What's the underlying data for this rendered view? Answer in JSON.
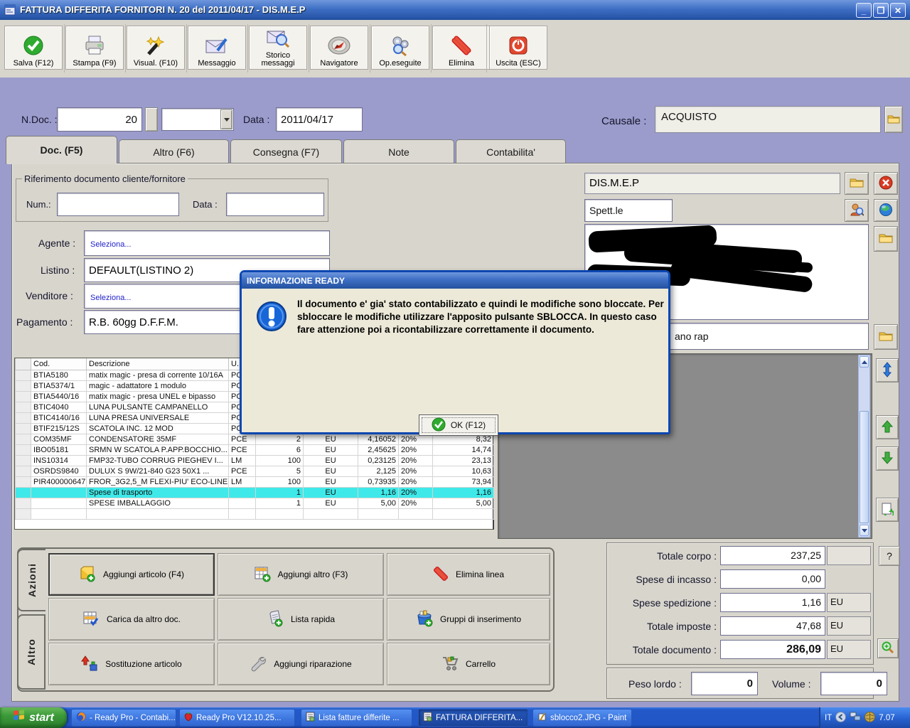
{
  "window": {
    "title": "FATTURA DIFFERITA FORNITORI N. 20  del 2011/04/17 - DIS.M.E.P"
  },
  "toolbar": {
    "buttons": [
      {
        "label": "Salva (F12)",
        "icon": "save-check-icon"
      },
      {
        "label": "Stampa (F9)",
        "icon": "printer-icon"
      },
      {
        "label": "Visual. (F10)",
        "icon": "magic-wand-icon"
      },
      {
        "label": "Messaggio",
        "icon": "envelope-pen-icon"
      },
      {
        "label": "Storico messaggi",
        "icon": "envelope-search-icon"
      },
      {
        "label": "Navigatore",
        "icon": "compass-icon"
      },
      {
        "label": "Op.eseguite",
        "icon": "gears-search-icon"
      },
      {
        "label": "Elimina",
        "icon": "red-x-icon"
      },
      {
        "label": "Uscita (ESC)",
        "icon": "power-icon"
      }
    ]
  },
  "header": {
    "ndoc_label": "N.Doc. :",
    "ndoc_value": "20",
    "data_label": "Data :",
    "data_value": "2011/04/17",
    "causale_label": "Causale :",
    "causale_value": "ACQUISTO"
  },
  "tabs": {
    "items": [
      "Doc. (F5)",
      "Altro (F6)",
      "Consegna (F7)",
      "Note",
      "Contabilita'"
    ]
  },
  "doc_tab": {
    "ref_title": "Riferimento documento cliente/fornitore",
    "num_label": "Num.:",
    "num_value": "",
    "data_label": "Data :",
    "data_value": "",
    "agente_label": "Agente :",
    "agente_value": "Seleziona...",
    "listino_label": "Listino :",
    "listino_value": "DEFAULT(LISTINO 2)",
    "venditore_label": "Venditore :",
    "venditore_value": "Seleziona...",
    "pagamento_label": "Pagamento :",
    "pagamento_value": "R.B. 60gg D.F.F.M."
  },
  "right_panel": {
    "supplier": "DIS.M.E.P",
    "salutation": "Spett.le",
    "note_value": "ano rap"
  },
  "grid": {
    "headers": [
      "",
      "Cod.",
      "Descrizione",
      "U.",
      "",
      "",
      "",
      "",
      ""
    ],
    "rows": [
      [
        "BTIA5180",
        "matix magic - presa di corrente 10/16A",
        "PCE",
        "",
        "",
        "",
        "",
        ""
      ],
      [
        "BTIA5374/1",
        "magic - adattatore 1 modulo",
        "PCE",
        "",
        "",
        "",
        "",
        ""
      ],
      [
        "BTIA5440/16",
        "matix magic - presa UNEL e bipasso",
        "PCE",
        "",
        "",
        "",
        "",
        ""
      ],
      [
        "BTIC4040",
        "LUNA PULSANTE CAMPANELLO",
        "PCE",
        "",
        "",
        "",
        "",
        ""
      ],
      [
        "BTIC4140/16",
        "LUNA PRESA UNIVERSALE",
        "PCE",
        "",
        "",
        "",
        "",
        ""
      ],
      [
        "BTIF215/12S",
        "SCATOLA INC. 12 MOD",
        "PCE",
        "",
        "",
        "",
        "",
        ""
      ],
      [
        "COM35MF",
        "CONDENSATORE 35MF",
        "PCE",
        "2",
        "EU",
        "4,16052",
        "20%",
        "8,32"
      ],
      [
        "IBO05181",
        "SRMN W SCATOLA P.APP.BOCCHIO...",
        "PCE",
        "6",
        "EU",
        "2,45625",
        "20%",
        "14,74"
      ],
      [
        "INS10314",
        "FMP32-TUBO CORRUG PIEGHEV  I...",
        "LM",
        "100",
        "EU",
        "0,23125",
        "20%",
        "23,13"
      ],
      [
        "OSRDS9840",
        "DULUX S 9W/21-840 G23 50X1    ...",
        "PCE",
        "5",
        "EU",
        "2,125",
        "20%",
        "10,63"
      ],
      [
        "PIR400000647",
        "FROR_3G2,5_M FLEXI-PIU' ECO-LINE",
        "LM",
        "100",
        "EU",
        "0,73935",
        "20%",
        "73,94"
      ],
      [
        "",
        "Spese di trasporto",
        "",
        "1",
        "EU",
        "1,16",
        "20%",
        "1,16"
      ],
      [
        "",
        "SPESE IMBALLAGGIO",
        "",
        "1",
        "EU",
        "5,00",
        "20%",
        "5,00"
      ],
      [
        "",
        "",
        "",
        "",
        "",
        "",
        "",
        ""
      ]
    ]
  },
  "dialog": {
    "title": "INFORMAZIONE READY",
    "message": "Il documento e' gia' stato contabilizzato e quindi le modifiche sono bloccate. Per sbloccare le modifiche utilizzare l'apposito pulsante SBLOCCA. In questo caso fare attenzione poi a ricontabilizzare correttamente il documento.",
    "ok_label": "OK (F12)"
  },
  "actions": {
    "tab_azioni": "Azioni",
    "tab_altro": "Altro",
    "buttons": [
      {
        "label": "Aggiungi articolo (F4)",
        "icon": "box-plus-icon"
      },
      {
        "label": "Aggiungi altro (F3)",
        "icon": "grid-plus-icon"
      },
      {
        "label": "Elimina linea",
        "icon": "red-x-icon"
      },
      {
        "label": "Carica da altro doc.",
        "icon": "grid-check-icon"
      },
      {
        "label": "Lista rapida",
        "icon": "list-plus-icon"
      },
      {
        "label": "Gruppi di inserimento",
        "icon": "bucket-plus-icon"
      },
      {
        "label": "Sostituzione articolo",
        "icon": "swap-arrows-icon"
      },
      {
        "label": "Aggiungi riparazione",
        "icon": "wrench-icon"
      },
      {
        "label": "Carrello",
        "icon": "cart-icon"
      }
    ]
  },
  "totals": {
    "corpo_label": "Totale corpo :",
    "corpo_value": "237,25",
    "incasso_label": "Spese di incasso :",
    "incasso_value": "0,00",
    "sped_label": "Spese spedizione :",
    "sped_value": "1,16",
    "sped_cur": "EU",
    "imposte_label": "Totale imposte :",
    "imposte_value": "47,68",
    "imposte_cur": "EU",
    "doc_label": "Totale documento :",
    "doc_value": "286,09",
    "doc_cur": "EU",
    "help_label": "?",
    "peso_label": "Peso lordo :",
    "peso_value": "0",
    "volume_label": "Volume :",
    "volume_value": "0"
  },
  "taskbar": {
    "start_label": "start",
    "items": [
      "- Ready Pro - Contabi...",
      "Ready Pro V12.10.25...",
      "Lista fatture differite ...",
      "FATTURA DIFFERITA...",
      "sblocco2.JPG - Paint"
    ],
    "tray_lang": "IT",
    "tray_time": "7.07"
  }
}
